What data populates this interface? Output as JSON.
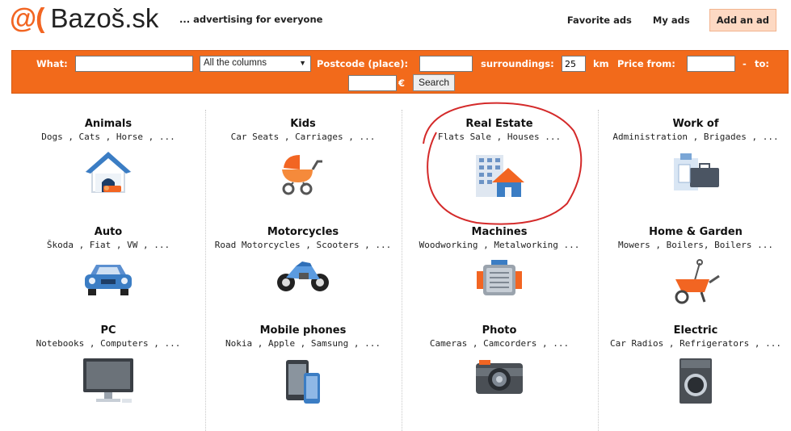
{
  "header": {
    "logo_mark": "@(",
    "logo_text": "Bazoš.sk",
    "tagline": "... advertising for everyone",
    "nav": {
      "favorite": "Favorite ads",
      "my_ads": "My ads",
      "add_ad": "Add an ad"
    }
  },
  "search": {
    "what_label": "What:",
    "what_value": "",
    "columns_value": "All the columns",
    "postcode_label": "Postcode  (place):",
    "postcode_value": "",
    "surroundings_label": "surroundings:",
    "surroundings_value": "25",
    "km_label": "km",
    "price_label": "Price  from:",
    "price_from_value": "",
    "dash": "-",
    "to_label": "to:",
    "price_to_value": "",
    "currency": "€",
    "search_button": "Search"
  },
  "categories": [
    {
      "title": "Animals",
      "sub": "Dogs , Cats , Horse , ...",
      "icon": "doghouse-icon"
    },
    {
      "title": "Kids",
      "sub": "Car Seats , Carriages , ...",
      "icon": "baby-carriage-icon"
    },
    {
      "title": "Real Estate",
      "sub": "Flats Sale , Houses ...",
      "icon": "buildings-icon"
    },
    {
      "title": "Work of",
      "sub": "Administration , Brigades , ...",
      "icon": "briefcase-icon"
    },
    {
      "title": "Auto",
      "sub": "Škoda , Fiat , VW , ...",
      "icon": "car-icon"
    },
    {
      "title": "Motorcycles",
      "sub": "Road Motorcycles , Scooters , ...",
      "icon": "motorcycle-icon"
    },
    {
      "title": "Machines",
      "sub": "Woodworking , Metalworking ...",
      "icon": "engine-icon"
    },
    {
      "title": "Home & Garden",
      "sub": "Mowers , Boilers, Boilers ...",
      "icon": "wheelbarrow-icon"
    },
    {
      "title": "PC",
      "sub": "Notebooks , Computers , ...",
      "icon": "monitor-icon"
    },
    {
      "title": "Mobile phones",
      "sub": "Nokia , Apple , Samsung , ...",
      "icon": "phones-icon"
    },
    {
      "title": "Photo",
      "sub": "Cameras , Camcorders , ...",
      "icon": "camera-icon"
    },
    {
      "title": "Electric",
      "sub": "Car Radios , Refrigerators , ...",
      "icon": "washing-machine-icon"
    }
  ],
  "colors": {
    "brand_orange": "#f26a1b",
    "annotation_red": "#d42a2a"
  }
}
